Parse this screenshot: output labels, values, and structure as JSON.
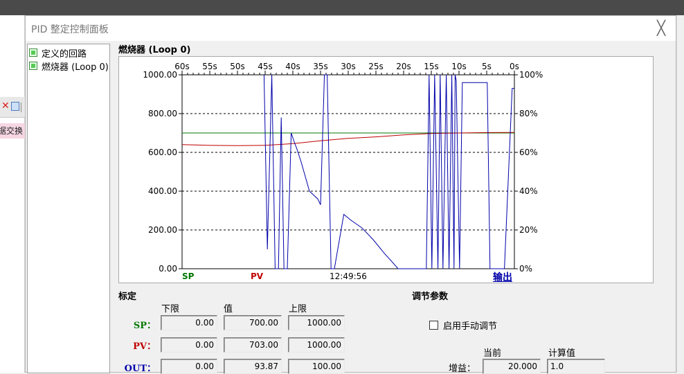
{
  "desktop": {
    "side_text": "据交换",
    "close_glyph": "✕"
  },
  "window": {
    "title": "PID 整定控制面板",
    "close_glyph": "╳"
  },
  "tree": {
    "items": [
      {
        "label": "定义的回路"
      },
      {
        "label": "燃烧器 (Loop 0)"
      }
    ]
  },
  "loop": {
    "title": "燃烧器 (Loop 0)"
  },
  "chart_data": {
    "type": "line",
    "x_ticks": [
      "60s",
      "55s",
      "50s",
      "45s",
      "40s",
      "35s",
      "30s",
      "25s",
      "20s",
      "15s",
      "10s",
      "5s",
      "0s"
    ],
    "y_left_ticks": [
      "1000.00",
      "800.00",
      "600.00",
      "400.00",
      "200.00",
      "0.00"
    ],
    "y_right_ticks": [
      "100%",
      "80%",
      "60%",
      "40%",
      "20%",
      "0%"
    ],
    "ylim": [
      0,
      1000
    ],
    "grid": true,
    "legend": {
      "sp": "SP",
      "pv": "PV",
      "time": "12:49:56",
      "out": "输出"
    },
    "colors": {
      "sp": "#007800",
      "pv": "#c00000",
      "out": "#0000aa"
    },
    "series": [
      {
        "name": "SP",
        "x": [
          60,
          0
        ],
        "values": [
          700,
          700
        ]
      },
      {
        "name": "PV",
        "x": [
          60,
          55,
          50,
          45,
          40,
          35,
          30,
          25,
          20,
          15,
          10,
          5,
          0
        ],
        "values": [
          640,
          636,
          635,
          636,
          645,
          660,
          672,
          680,
          690,
          697,
          700,
          702,
          703
        ]
      },
      {
        "name": "输出",
        "unit": "%",
        "x": [
          45.2,
          44.6,
          43.8,
          43.2,
          42.6,
          42.1,
          41.6,
          41.0,
          40.3,
          39.7,
          39.3,
          38.5,
          37.0,
          35.5,
          35.0,
          34.3,
          33.8,
          33.1,
          32.5,
          30.8,
          29.5,
          27.5,
          25.5,
          23.5,
          21.6,
          21.0,
          15.9,
          15.4,
          14.9,
          14.4,
          13.8,
          13.4,
          12.9,
          12.3,
          11.8,
          11.3,
          10.9,
          10.7,
          10.5,
          9.9,
          9.4,
          7.9,
          5.6,
          5.0,
          4.9,
          4.4,
          4.1,
          3.5,
          3.3,
          2.9,
          2.3,
          1.8,
          0.4,
          0
        ],
        "values": [
          100,
          10,
          100,
          0,
          0,
          78,
          0,
          0,
          70,
          65,
          62,
          55,
          40,
          36,
          33,
          100,
          100,
          0,
          0,
          28,
          25,
          21,
          15,
          8,
          2,
          0,
          0,
          100,
          0,
          100,
          0,
          100,
          0,
          100,
          0,
          100,
          0,
          100,
          97,
          0,
          96,
          96,
          96,
          96,
          96,
          0,
          0,
          0,
          0,
          0,
          0,
          0,
          93,
          93
        ]
      }
    ]
  },
  "calibration": {
    "title": "标定",
    "headers": {
      "low": "下限",
      "value": "值",
      "high": "上限"
    },
    "rows": [
      {
        "label": "SP：",
        "low": "0.00",
        "value": "700.00",
        "high": "1000.00",
        "color": "#007800"
      },
      {
        "label": "PV：",
        "low": "0.00",
        "value": "703.00",
        "high": "1000.00",
        "color": "#c00000"
      },
      {
        "label": "OUT：",
        "low": "0.00",
        "value": "93.87",
        "high": "100.00",
        "color": "#0000aa"
      }
    ]
  },
  "tuning": {
    "title": "调节参数",
    "manual_label": "启用手动调节",
    "manual_checked": false,
    "headers": {
      "current": "当前",
      "calculated": "计算值"
    },
    "gain_label": "增益：",
    "gain_current": "20.000",
    "gain_calculated": "1.0"
  }
}
